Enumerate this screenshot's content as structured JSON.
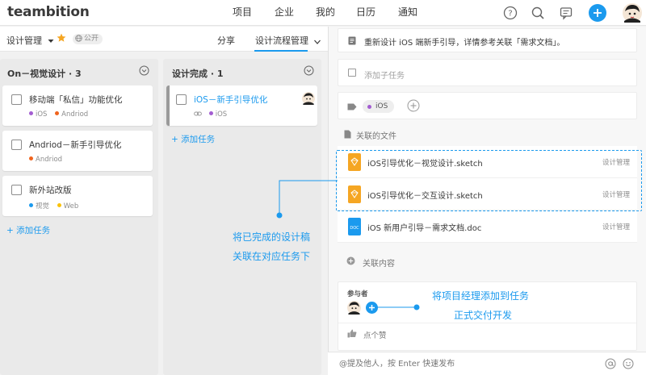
{
  "app": {
    "logo": "teambition",
    "nav": [
      "项目",
      "企业",
      "我的",
      "日历",
      "通知"
    ]
  },
  "project": {
    "name": "设计管理",
    "visibility": "公开",
    "tabs": [
      "分享",
      "设计流程管理"
    ]
  },
  "columns": [
    {
      "title": "On－视觉设计 · 3",
      "cards": [
        {
          "title": "移动端「私信」功能优化",
          "tags": [
            {
              "label": "iOS",
              "color": "#a35dd1"
            },
            {
              "label": "Andriod",
              "color": "#f0641e"
            }
          ]
        },
        {
          "title": "Andriod－新手引导优化",
          "tags": [
            {
              "label": "Andriod",
              "color": "#f0641e"
            }
          ]
        },
        {
          "title": "新外站改版",
          "tags": [
            {
              "label": "视觉",
              "color": "#1b9aee"
            },
            {
              "label": "Web",
              "color": "#fac20a"
            }
          ]
        }
      ],
      "add_label": "添加任务"
    },
    {
      "title": "设计完成 · 1",
      "cards": [
        {
          "title": "iOS－新手引导优化",
          "tags": [
            {
              "label": "iOS",
              "color": "#a35dd1"
            }
          ]
        }
      ],
      "add_label": "添加任务"
    }
  ],
  "detail": {
    "description": "重新设计 iOS 端新手引导，详情参考关联「需求文档」。",
    "add_subtask": "添加子任务",
    "tag": "iOS",
    "files_label": "关联的文件",
    "files": [
      {
        "name": "iOS引导优化－视觉设计.sketch",
        "project": "设计管理",
        "type": "sketch"
      },
      {
        "name": "iOS引导优化－交互设计.sketch",
        "project": "设计管理",
        "type": "sketch"
      },
      {
        "name": "iOS 新用户引导－需求文档.doc",
        "project": "设计管理",
        "type": "doc"
      }
    ],
    "link_content": "关联内容",
    "participants_label": "参与者",
    "like_label": "点个赞",
    "comment_placeholder": "@提及他人，按 Enter 快速发布"
  },
  "annotations": {
    "files_note": [
      "将已完成的设计稿",
      "关联在对应任务下"
    ],
    "participant_note": [
      "将项目经理添加到任务",
      "正式交付开发"
    ]
  },
  "colors": {
    "accent": "#1b9aee",
    "sketch_icon": "#f5a623",
    "doc_icon": "#1b9aee",
    "star": "#f5a623"
  }
}
